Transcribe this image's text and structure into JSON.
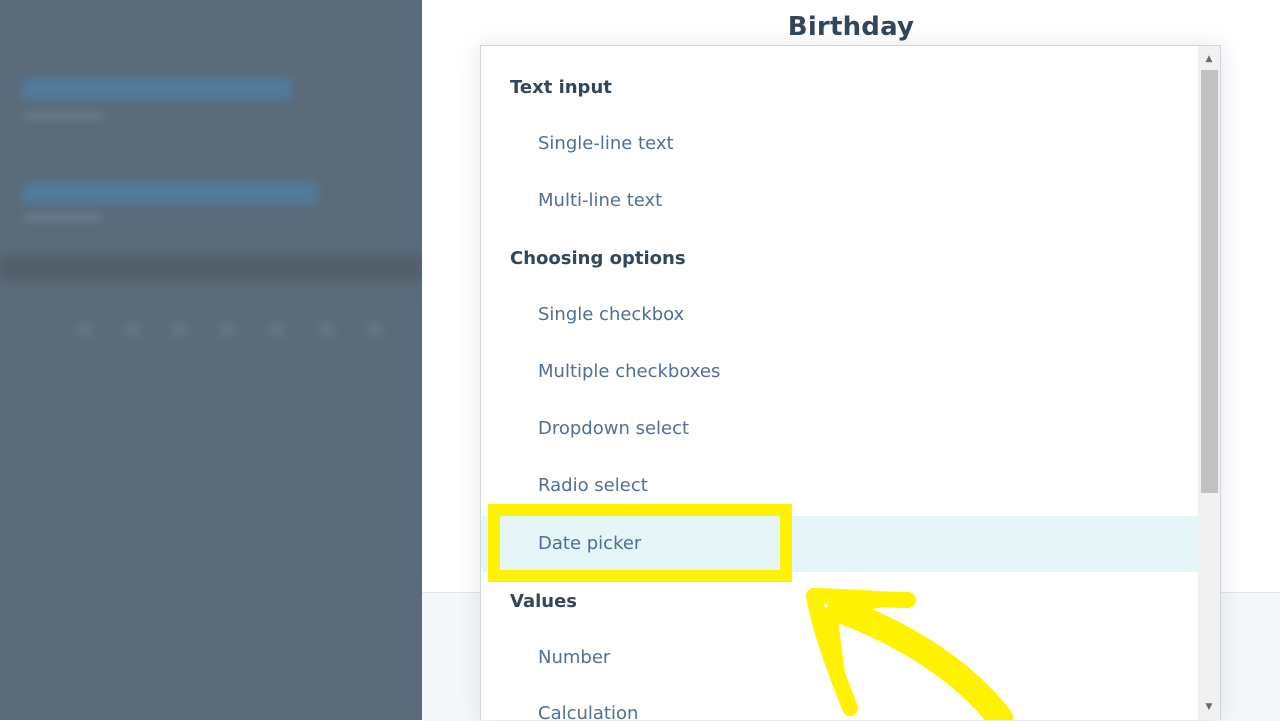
{
  "panel": {
    "title": "Birthday"
  },
  "dropdown": {
    "groups": [
      {
        "label": "Text input",
        "options": [
          "Single-line text",
          "Multi-line text"
        ]
      },
      {
        "label": "Choosing options",
        "options": [
          "Single checkbox",
          "Multiple checkboxes",
          "Dropdown select",
          "Radio select",
          "Date picker"
        ]
      },
      {
        "label": "Values",
        "options": [
          "Number",
          "Calculation"
        ]
      }
    ],
    "highlighted_option": "Date picker"
  },
  "scrollbar": {
    "up_icon": "triangle-up-icon",
    "down_icon": "triangle-down-icon"
  },
  "annotation": {
    "color": "#fff200",
    "arrow_icon": "hand-drawn-arrow-icon"
  },
  "colors": {
    "overlay": "#5b6b7a",
    "hover": "#e5f5f8",
    "header_text": "#33475b",
    "option_text": "#516f90"
  }
}
